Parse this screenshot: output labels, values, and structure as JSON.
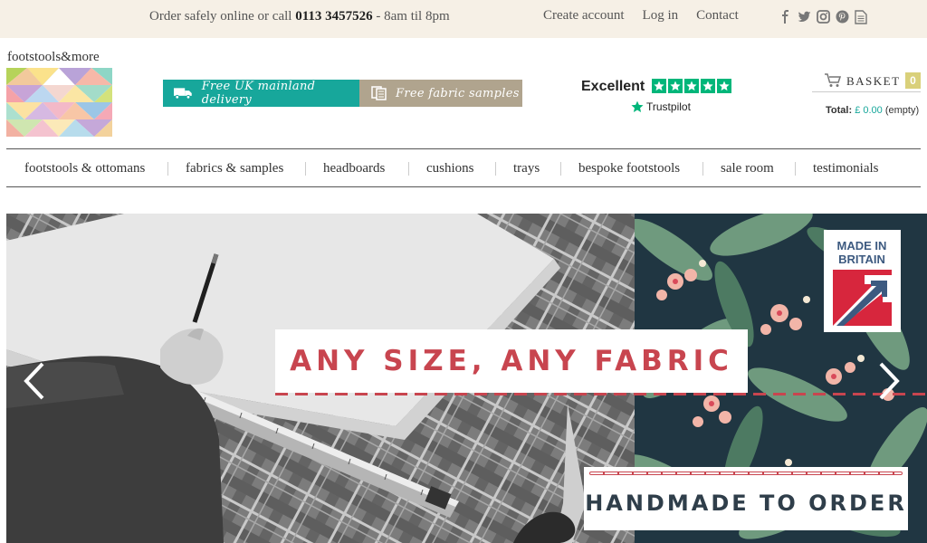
{
  "topbar": {
    "contact_prefix": "Order safely online or call ",
    "phone": "0113 3457526",
    "hours": " - 8am til 8pm",
    "links": {
      "create_account": "Create account",
      "login": "Log in",
      "contact": "Contact"
    },
    "social_icons": [
      "facebook-icon",
      "twitter-icon",
      "instagram-icon",
      "pinterest-icon",
      "document-icon"
    ]
  },
  "header": {
    "logo_text": "footstools&more",
    "banners": {
      "delivery": "Free UK mainland delivery",
      "samples": "Free fabric samples"
    },
    "trustpilot": {
      "rating_text": "Excellent",
      "stars": 5,
      "brand": "Trustpilot"
    },
    "basket": {
      "label": "BASKET",
      "count": "0",
      "total_label": "Total:",
      "total_value": "£ 0.00",
      "total_state": "(empty)"
    }
  },
  "nav": {
    "items": [
      "footstools & ottomans",
      "fabrics & samples",
      "headboards",
      "cushions",
      "trays",
      "bespoke footstools",
      "sale room",
      "testimonials"
    ]
  },
  "hero": {
    "caption_primary": "ANY SIZE, ANY FABRIC",
    "caption_secondary": "HANDMADE TO ORDER",
    "badge_line1": "MADE IN",
    "badge_line2": "BRITAIN"
  },
  "colors": {
    "teal": "#17a79b",
    "taupe": "#b0a48e",
    "red": "#c8454f",
    "navy": "#203642",
    "cream": "#f6f0e6",
    "trustpilot_green": "#00b67a"
  }
}
